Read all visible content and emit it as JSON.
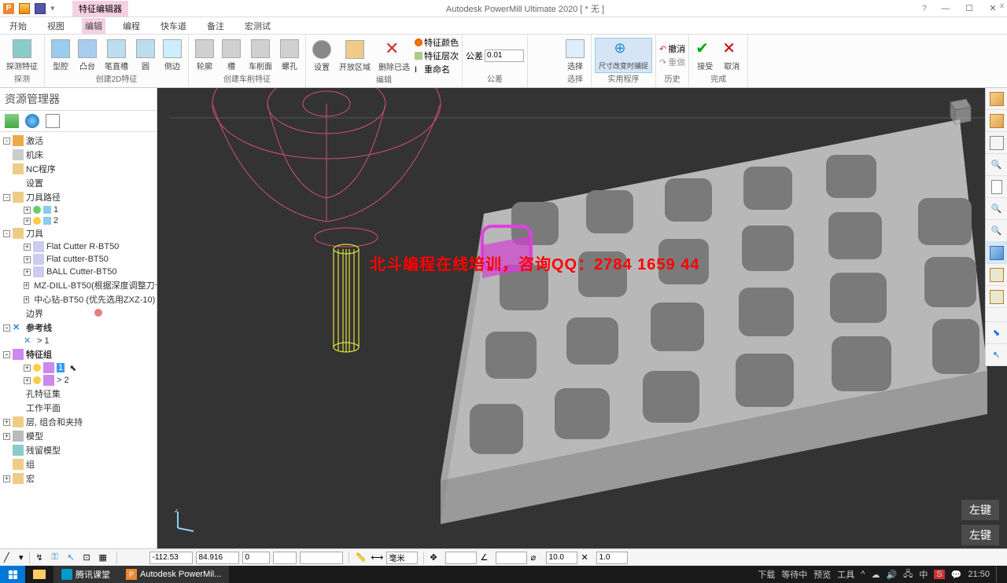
{
  "app": {
    "title": "Autodesk PowerMill Ultimate 2020     [ * 无 ]",
    "context_tab": "特征编辑器"
  },
  "menu": {
    "items": [
      "开始",
      "视图",
      "编辑",
      "编程",
      "快车道",
      "备注",
      "宏测试"
    ],
    "active_index": 2
  },
  "ribbon": {
    "groups": {
      "detect": {
        "label": "探测",
        "detect": "探测特征"
      },
      "create2d": {
        "label": "创建2D特征",
        "cavity": "型腔",
        "boss": "凸台",
        "straight": "笔直槽",
        "circle": "圆",
        "side": "侧边"
      },
      "createturn": {
        "label": "创建车削特征",
        "wheel": "轮廓",
        "slot": "槽",
        "face": "车削面",
        "hole": "螺孔"
      },
      "edit": {
        "label": "编辑",
        "setup": "设置",
        "open": "开放区域",
        "remove": "删除已选",
        "featcolor": "特征颜色",
        "featlayer": "特征层次",
        "rename": "重命名"
      },
      "tolerance": {
        "label": "公差",
        "prefix": "公差",
        "value": "0.01"
      },
      "select": {
        "label": "选择",
        "select": "选择"
      },
      "utility": {
        "label": "实用程序",
        "snap": "尺寸改变时捕捉"
      },
      "history": {
        "label": "历史",
        "undo": "撤消",
        "redo": "重做"
      },
      "finish": {
        "label": "完成",
        "accept": "接受",
        "cancel": "取消"
      }
    }
  },
  "sidebar": {
    "title": "资源管理器",
    "tree": {
      "activate": "激活",
      "machine": "机床",
      "nc": "NC程序",
      "setup": "设置",
      "toolpaths": "刀具路径",
      "tp1": "1",
      "tp2": "2",
      "tools": "刀具",
      "tool_items": [
        "Flat Cutter R-BT50",
        "Flat cutter-BT50",
        "BALL Cutter-BT50",
        "MZ-DILL-BT50(根据深度调整刀长)",
        "中心钻-BT50 (优先选用ZXZ-10)"
      ],
      "boundary": "边界",
      "reference": "参考线",
      "ref1": "> 1",
      "featuregroup": "特征组",
      "fg1": "1",
      "fg2": "> 2",
      "holefeat": "孔特征集",
      "workplane": "工作平面",
      "layers": "层, 组合和夹持",
      "model": "模型",
      "stock": "残留模型",
      "group": "组",
      "macro": "宏"
    }
  },
  "viewport": {
    "watermark": "北斗编程在线培训，咨询QQ：2784 1659 44",
    "axis_label": "z"
  },
  "click_labels": [
    "左键",
    "左键"
  ],
  "statusbar": {
    "x": "-112.53",
    "y": "84.916",
    "z": "0",
    "unit": "毫米",
    "val1": "10.0",
    "val2": "1.0"
  },
  "taskbar": {
    "app1": "腾讯课堂",
    "app2": "Autodesk PowerMil...",
    "tray_items": [
      "下载",
      "等待中",
      "预览",
      "工具"
    ],
    "time": "21:50",
    "date": ""
  }
}
